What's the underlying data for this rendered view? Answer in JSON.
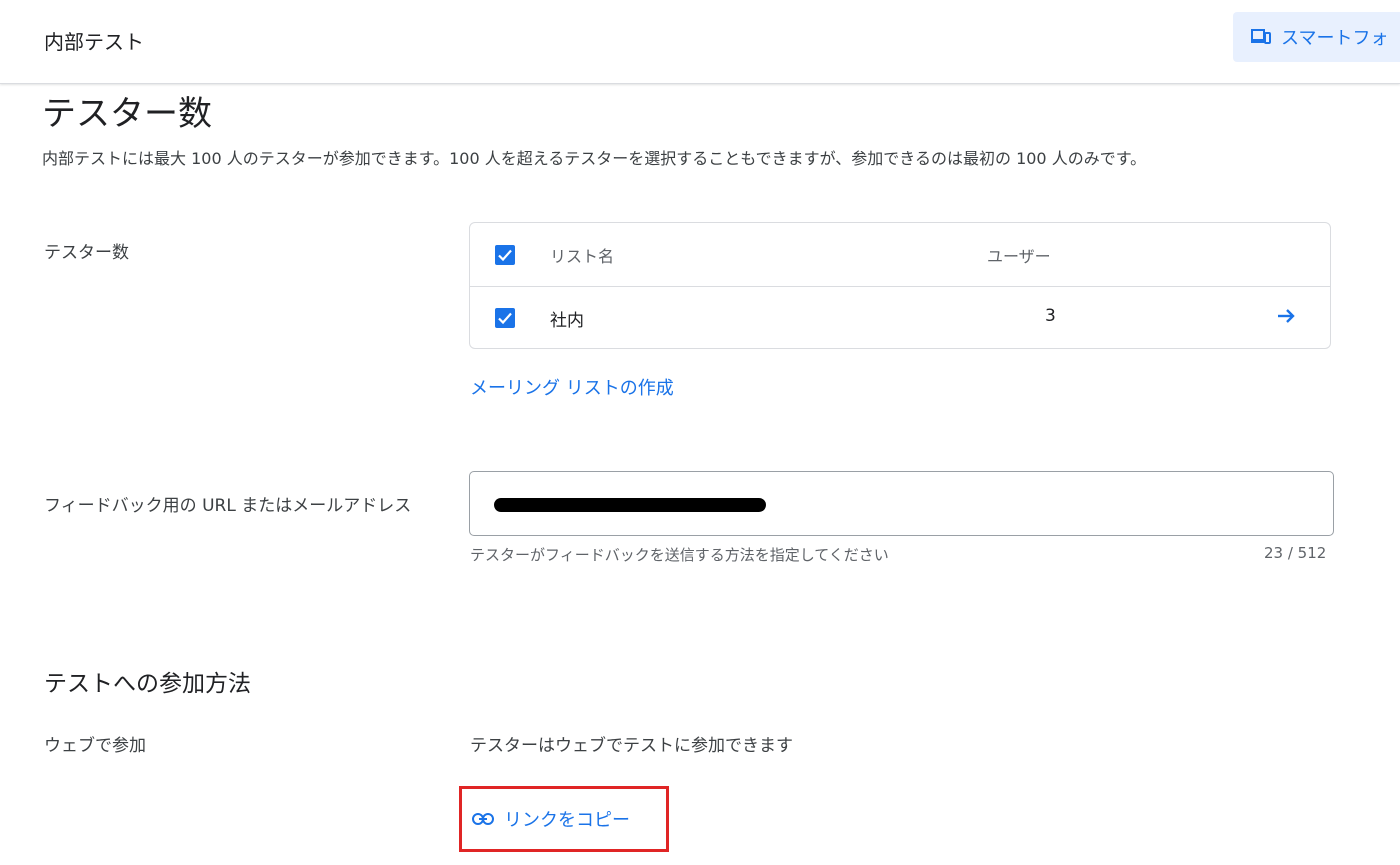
{
  "header": {
    "title": "内部テスト",
    "device_button_label": "スマートフォ"
  },
  "section": {
    "heading": "テスター数",
    "description": "内部テストには最大 100 人のテスターが参加できます。100 人を超えるテスターを選択することもできますが、参加できるのは最初の 100 人のみです。"
  },
  "testers": {
    "label": "テスター数",
    "table": {
      "columns": [
        "リスト名",
        "ユーザー"
      ],
      "rows": [
        {
          "checked": true,
          "name": "社内",
          "users": "3",
          "action_icon": "arrow-right-icon"
        }
      ],
      "header_checked": true
    },
    "create_list_link": "メーリング リストの作成"
  },
  "feedback": {
    "label": "フィードバック用の URL またはメールアドレス",
    "value_redacted": true,
    "helper": "テスターがフィードバックを送信する方法を指定してください",
    "counter": "23 / 512"
  },
  "join": {
    "heading": "テストへの参加方法",
    "web_label": "ウェブで参加",
    "web_description": "テスターはウェブでテストに参加できます",
    "copy_link_label": "リンクをコピー",
    "copy_link_icon": "link-icon"
  },
  "colors": {
    "accent": "#1a73e8",
    "highlight_border": "#e02525",
    "device_button_bg": "#e8f0fe"
  }
}
